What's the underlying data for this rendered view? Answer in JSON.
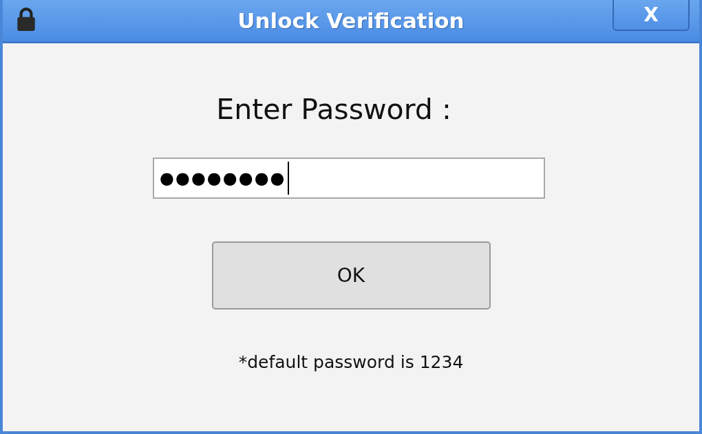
{
  "window": {
    "title": "Unlock Verification",
    "close_label": "X"
  },
  "prompt": "Enter Password :",
  "password_field": {
    "value": "●●●●●●●●",
    "focused": true
  },
  "buttons": [
    "OK"
  ],
  "note": "*default password is 1234"
}
